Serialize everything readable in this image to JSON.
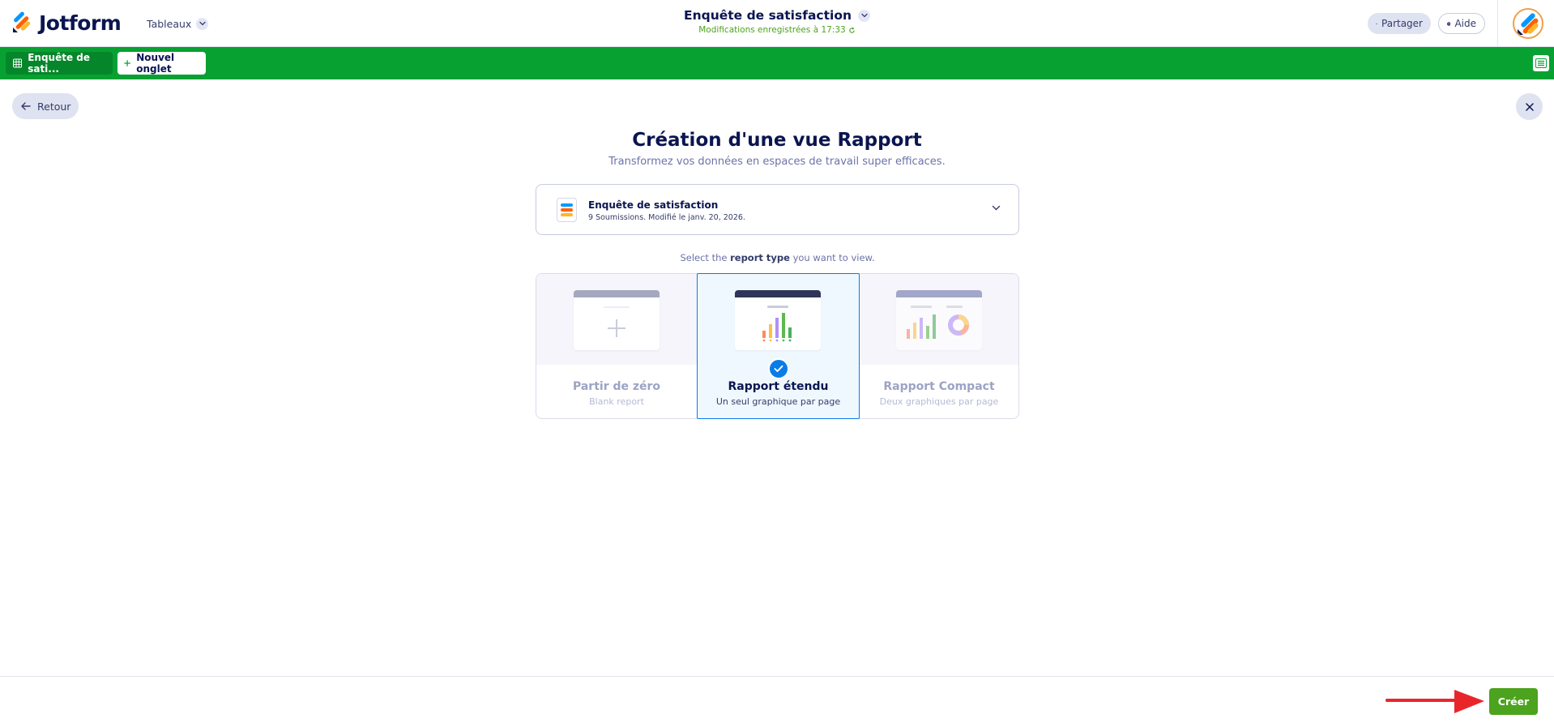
{
  "header": {
    "logo_text": "Jotform",
    "tables_label": "Tableaux",
    "form_title": "Enquête de satisfaction",
    "save_status": "Modifications enregistrées à 17:33",
    "share_label": "Partager",
    "help_label": "Aide"
  },
  "tabs": {
    "active_tab": "Enquête de sati...",
    "new_tab": "Nouvel onglet"
  },
  "main": {
    "back_label": "Retour",
    "title": "Création d'une vue Rapport",
    "subtitle": "Transformez vos données en espaces de travail super efficaces.",
    "form_select": {
      "name": "Enquête de satisfaction",
      "meta": "9 Soumissions. Modifié le janv. 20, 2026."
    },
    "prompt": {
      "before": "Select the ",
      "bold": "report type",
      "after": " you want to view."
    },
    "report_types": [
      {
        "name": "Partir de zéro",
        "desc": "Blank report",
        "selected": false
      },
      {
        "name": "Rapport étendu",
        "desc": "Un seul graphique par page",
        "selected": true
      },
      {
        "name": "Rapport Compact",
        "desc": "Deux graphiques par page",
        "selected": false
      }
    ]
  },
  "footer": {
    "create_label": "Créer"
  },
  "colors": {
    "brand_green": "#07a132",
    "create_green": "#4ca31e",
    "accent_blue": "#0a7ce8",
    "navy": "#0a1551",
    "annotation_red": "#e8262a"
  },
  "icons": [
    "jotform-logo",
    "chevron-down-icon",
    "share-arrow-icon",
    "help-icon",
    "avatar",
    "table-icon",
    "plus-icon",
    "list-menu-icon",
    "arrow-left-icon",
    "close-icon",
    "form-icon",
    "check-icon",
    "red-arrow-annotation"
  ]
}
